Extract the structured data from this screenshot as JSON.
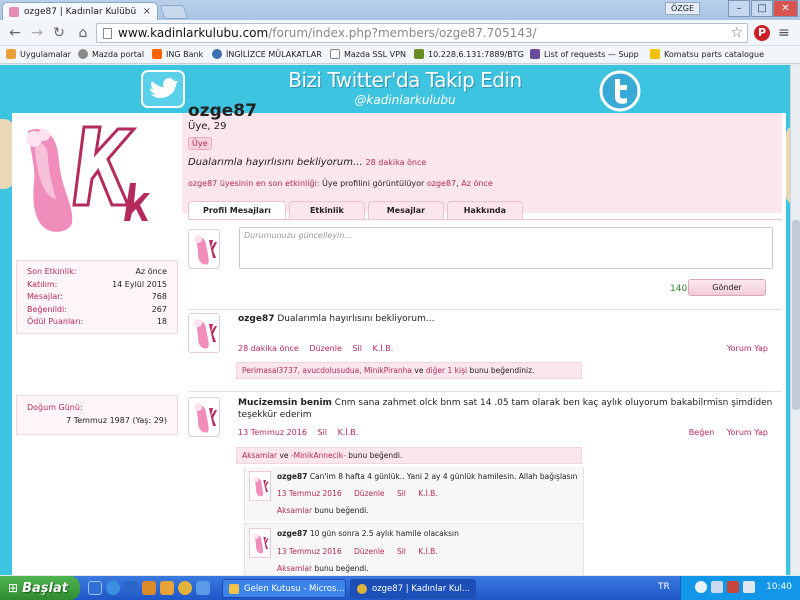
{
  "browser": {
    "tab_title": "ozge87 | Kadınlar Kulübü",
    "tab_close": "×",
    "user_name": "ÖZGE",
    "window_min": "–",
    "window_max": "□",
    "window_close": "✕",
    "url_host": "www.kadinlarkulubu.com",
    "url_path": "/forum/index.php?members/ozge87.705143/",
    "bookmarks": [
      "Uygulamalar",
      "Mazda portal",
      "ING Bank",
      "İNGİLİZCE MÜLAKATLAR",
      "Mazda SSL VPN",
      "10.228.6.131:7889/BTG",
      "List of requests — Supp",
      "Komatsu parts catalogue"
    ]
  },
  "banner": {
    "title": "Bizi Twitter'da Takip Edin",
    "handle": "@kadinlarkulubu"
  },
  "sidebar": {
    "stats": [
      {
        "label": "Son Etkinlik:",
        "value": "Az önce"
      },
      {
        "label": "Katılım:",
        "value": "14 Eylül 2015"
      },
      {
        "label": "Mesajlar:",
        "value": "768"
      },
      {
        "label": "Beğenildi:",
        "value": "267"
      },
      {
        "label": "Ödül Puanları:",
        "value": "18"
      }
    ],
    "birthday_label": "Doğum Günü:",
    "birthday_value": "7 Temmuz 1987 (Yaş: 29)"
  },
  "profile": {
    "username": "ozge87",
    "title": "Üye, 29",
    "badge": "Üye",
    "status_text": "Dualarımla hayırlısını bekliyorum...",
    "status_time": "28 dakika önce",
    "activity_prefix": "ozge87 üyesinin en son etkinliği:",
    "activity_text": "Üye profilini görüntülüyor",
    "activity_user": "ozge87",
    "activity_sep": ",",
    "activity_time": "Az önce"
  },
  "tabs": [
    "Profil Mesajları",
    "Etkinlik",
    "Mesajlar",
    "Hakkında"
  ],
  "post_box": {
    "placeholder": "Durumunuzu güncelleyin...",
    "counter": "140",
    "send": "Gönder"
  },
  "messages": [
    {
      "author": "ozge87",
      "text": "Dualarımla hayırlısını bekliyorum...",
      "time": "28 dakika önce",
      "actions": [
        "Düzenle",
        "Sil",
        "K.İ.B."
      ],
      "right_actions": [
        "Yorum Yap"
      ],
      "likes_names": "Perimasal3737, avucdolusudua, MinikPiranha",
      "likes_and": "ve",
      "likes_more": "diğer 1 kişi",
      "likes_suffix": "bunu beğendiniz."
    },
    {
      "author": "Mucizemsin benim",
      "text": "Cnm sana zahmet olck bnm sat 14 .05 tam olarak ben kaç aylık oluyorum bakabilrmisn şimdiden teşekkür ederim",
      "time": "13 Temmuz 2016",
      "actions": [
        "Sil",
        "K.İ.B."
      ],
      "right_actions": [
        "Beğen",
        "Yorum Yap"
      ],
      "likes_names": "Aksamlar",
      "likes_and": "ve",
      "likes_more": "-MinikAnnecik-",
      "likes_suffix": "bunu beğendi."
    }
  ],
  "comments": [
    {
      "author": "ozge87",
      "text": "Can'im 8 hafta 4 günlük.. Yani 2 ay 4 günlük hamilesin. Allah bağışlasın",
      "time": "13 Temmuz 2016",
      "actions": [
        "Düzenle",
        "Sil",
        "K.İ.B."
      ],
      "like_user": "Aksamlar",
      "like_suffix": "bunu beğendi."
    },
    {
      "author": "ozge87",
      "text": "10 gün sonra 2.5 aylık hamile olacaksın",
      "time": "13 Temmuz 2016",
      "actions": [
        "Düzenle",
        "Sil",
        "K.İ.B."
      ],
      "like_user": "Aksamlar",
      "like_suffix": "bunu beğendi."
    }
  ],
  "taskbar": {
    "start": "Başlat",
    "tasks": [
      "Gelen Kutusu - Micros...",
      "ozge87 | Kadınlar Kul..."
    ],
    "lang": "TR",
    "clock": "10:40"
  },
  "colors": {
    "accent_pink": "#b42a5a",
    "banner_blue": "#3cc4e0",
    "header_pink": "#fbe6ee"
  }
}
